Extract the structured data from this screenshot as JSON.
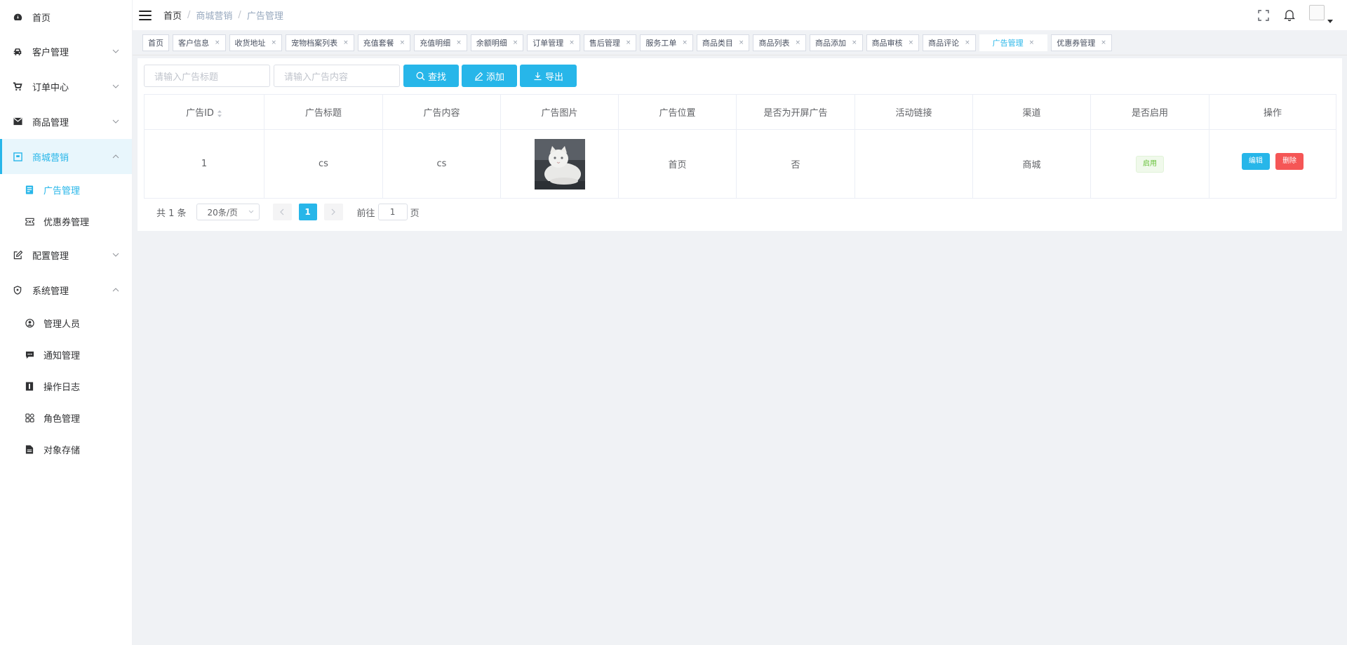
{
  "sidebar": {
    "home": "首页",
    "customer": "客户管理",
    "orders": "订单中心",
    "products": "商品管理",
    "marketing": "商城营销",
    "marketing_sub": [
      "广告管理",
      "优惠券管理"
    ],
    "config": "配置管理",
    "system": "系统管理",
    "system_sub": [
      "管理人员",
      "通知管理",
      "操作日志",
      "角色管理",
      "对象存储"
    ]
  },
  "header": {
    "breadcrumb": [
      "首页",
      "商城营销",
      "广告管理"
    ]
  },
  "tabs": [
    "首页",
    "客户信息",
    "收货地址",
    "宠物档案列表",
    "充值套餐",
    "充值明细",
    "余额明细",
    "订单管理",
    "售后管理",
    "服务工单",
    "商品类目",
    "商品列表",
    "商品添加",
    "商品审核",
    "商品评论",
    "广告管理",
    "优惠券管理"
  ],
  "tab_close": "×",
  "toolbar": {
    "title_placeholder": "请输入广告标题",
    "content_placeholder": "请输入广告内容",
    "search": "查找",
    "add": "添加",
    "export": "导出"
  },
  "table": {
    "columns": [
      "广告ID",
      "广告标题",
      "广告内容",
      "广告图片",
      "广告位置",
      "是否为开屏广告",
      "活动链接",
      "渠道",
      "是否启用",
      "操作"
    ],
    "rows": [
      {
        "id": "1",
        "title": "cs",
        "content": "cs",
        "position": "首页",
        "splash": "否",
        "link": "",
        "channel": "商城",
        "enabled": "启用",
        "edit": "编辑",
        "delete": "删除"
      }
    ]
  },
  "pagination": {
    "total": "共 1 条",
    "page_size": "20条/页",
    "current": "1",
    "goto_prefix": "前往",
    "goto_value": "1",
    "goto_suffix": "页"
  },
  "colors": {
    "accent": "#27b6e9",
    "danger": "#f55656",
    "success": "#67c23a"
  }
}
